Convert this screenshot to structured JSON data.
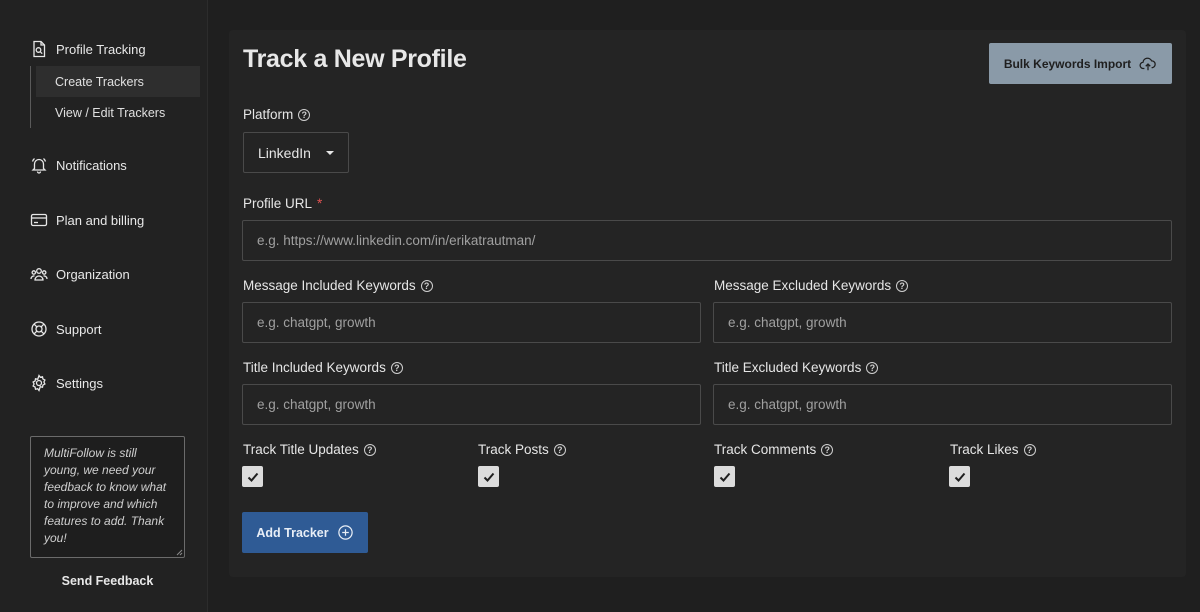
{
  "sidebar": {
    "profile_tracking": "Profile Tracking",
    "sub_items": [
      "Create Trackers",
      "View / Edit Trackers"
    ],
    "notifications": "Notifications",
    "plan_billing": "Plan and billing",
    "organization": "Organization",
    "support": "Support",
    "settings": "Settings",
    "feedback_text": "MultiFollow is still young, we need your feedback to know what to improve and which features to add. Thank you!",
    "send_feedback": "Send Feedback"
  },
  "main": {
    "title": "Track a New Profile",
    "bulk_import": "Bulk Keywords Import",
    "platform_label": "Platform",
    "platform_value": "LinkedIn",
    "profile_url_label": "Profile URL",
    "profile_url_required": "*",
    "profile_url_placeholder": "e.g. https://www.linkedin.com/in/erikatrautman/",
    "msg_included_label": "Message Included Keywords",
    "msg_excluded_label": "Message Excluded Keywords",
    "title_included_label": "Title Included Keywords",
    "title_excluded_label": "Title Excluded Keywords",
    "keywords_placeholder": "e.g. chatgpt, growth",
    "track_title_updates": "Track Title Updates",
    "track_posts": "Track Posts",
    "track_comments": "Track Comments",
    "track_likes": "Track Likes",
    "add_tracker": "Add Tracker",
    "help_glyph": "?"
  },
  "colors": {
    "accent_blue": "#2f5b95",
    "bulk_button": "#8a9aa8",
    "required": "#e05252"
  }
}
